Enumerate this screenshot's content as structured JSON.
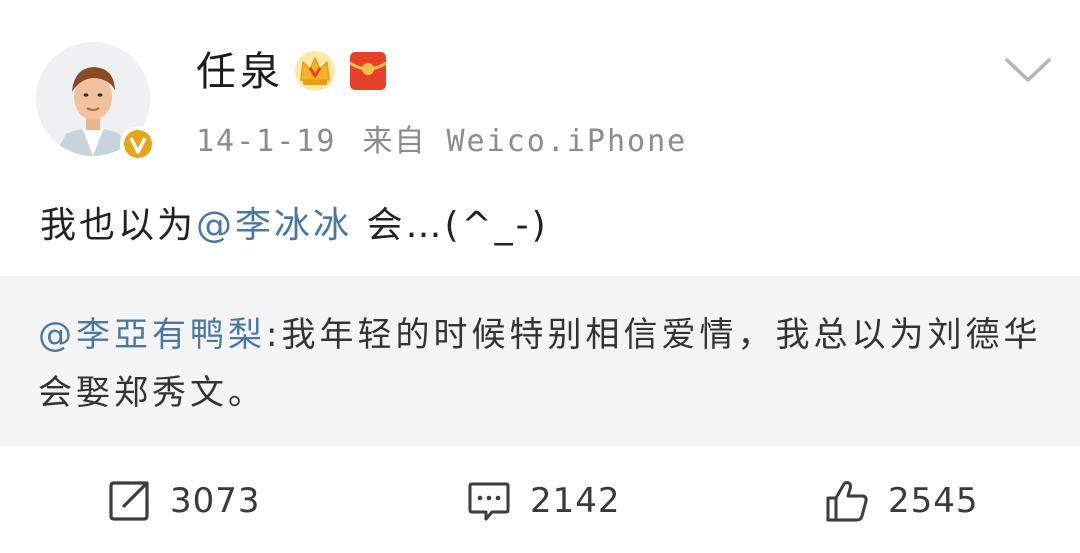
{
  "post": {
    "author": "任泉",
    "date": "14-1-19",
    "source": "来自 Weico.iPhone",
    "text_prefix": "我也以为",
    "mention": "@李冰冰",
    "text_suffix": " 会…(^_-)"
  },
  "retweet": {
    "mention": "@李亞有鸭梨",
    "text": ":我年轻的时候特别相信爱情，我总以为刘德华会娶郑秀文。"
  },
  "actions": {
    "repost_count": "3073",
    "comment_count": "2142",
    "like_count": "2545"
  },
  "icons": {
    "verified": "verified-v-badge-icon",
    "vip": "vip-crown-icon",
    "red_packet": "red-packet-icon",
    "more": "chevron-down-icon",
    "repost": "repost-icon",
    "comment": "comment-icon",
    "like": "thumbs-up-icon"
  },
  "colors": {
    "mention": "#4c78a0",
    "verified_badge": "#e8a51b",
    "red_packet": "#e8412b",
    "retweet_bg": "#f4f4f4"
  }
}
